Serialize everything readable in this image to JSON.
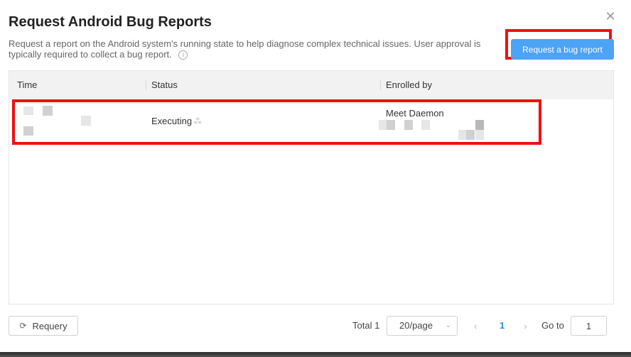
{
  "dialog": {
    "title": "Request Android Bug Reports",
    "close_icon": "close-icon",
    "description": "Request a report on the Android system's running state to help diagnose complex technical issues. User approval is typically required to collect a bug report.",
    "info_icon": "i",
    "request_button_label": "Request a bug report"
  },
  "table": {
    "columns": [
      "Time",
      "Status",
      "Enrolled by"
    ],
    "rows": [
      {
        "time": "",
        "status": "Executing",
        "enrolled_by": "Meet Daemon"
      }
    ]
  },
  "footer": {
    "requery_label": "Requery",
    "total_label": "Total 1",
    "page_size": "20/page",
    "current_page": "1",
    "goto_label": "Go to",
    "goto_value": "1"
  },
  "colors": {
    "primary": "#4da3f5",
    "highlight": "#ee1111"
  }
}
